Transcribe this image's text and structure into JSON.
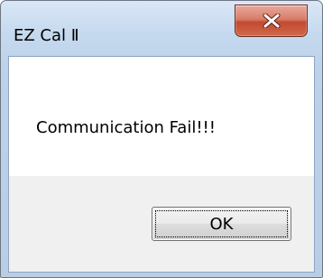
{
  "window": {
    "title": "EZ Cal Ⅱ"
  },
  "title_buttons": {
    "close_icon": "close-icon"
  },
  "dialog": {
    "message": "Communication Fail!!!",
    "ok_label": "OK"
  },
  "colors": {
    "close_button": "#c24a30",
    "frame": "#bdd1e9",
    "button_area": "#f0f0f0"
  }
}
